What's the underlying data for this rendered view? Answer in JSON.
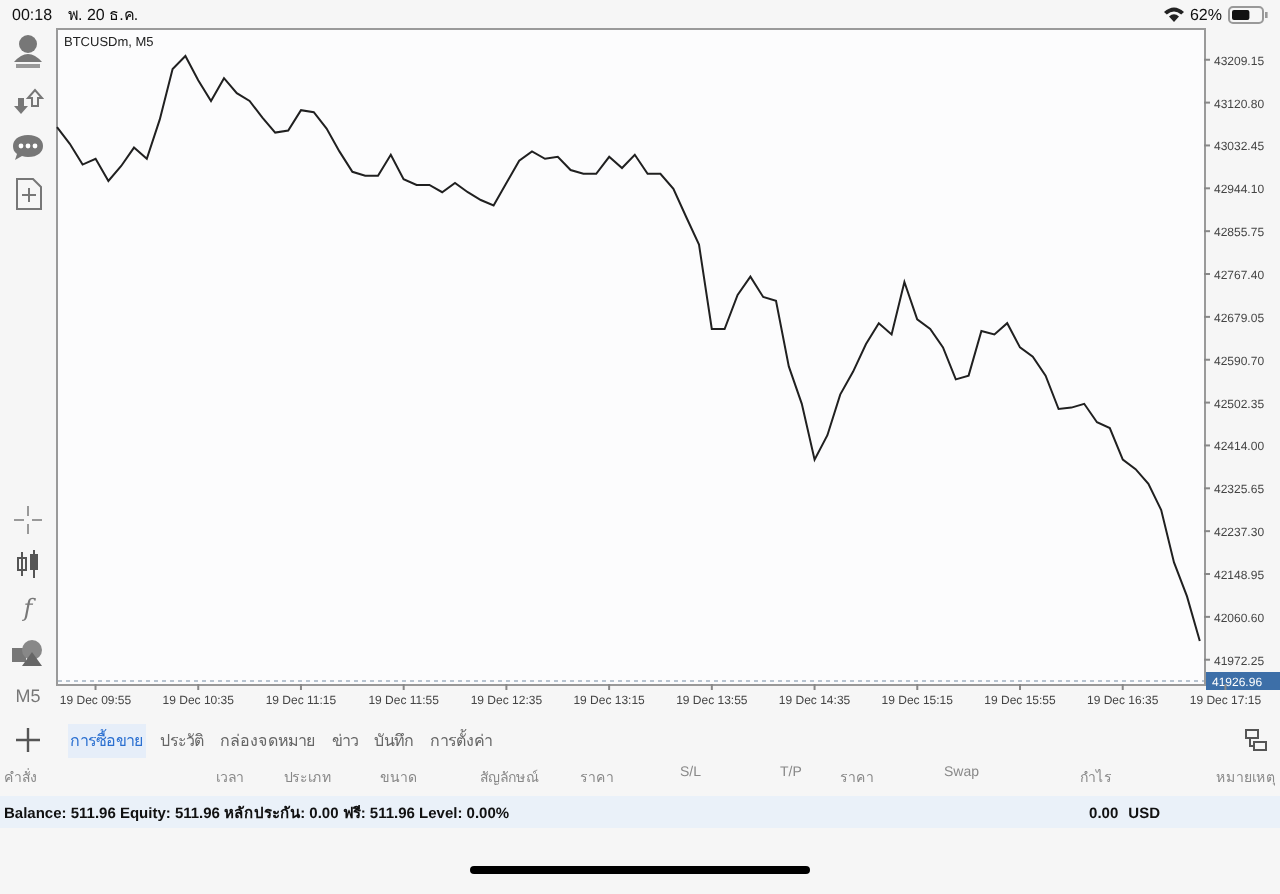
{
  "status_bar": {
    "time": "00:18",
    "date": "พ. 20 ธ.ค.",
    "battery_text": "62%"
  },
  "toolbar": [
    {
      "kind": "icon"
    },
    {
      "kind": "icon"
    },
    {
      "kind": "icon"
    },
    {
      "kind": "icon"
    },
    {
      "kind": "gap"
    },
    {
      "kind": "icon"
    },
    {
      "kind": "icon"
    },
    {
      "kind": "glyph",
      "text": "f"
    },
    {
      "kind": "icon"
    },
    {
      "kind": "text",
      "text": "M5"
    }
  ],
  "chart": {
    "title": "BTCUSDm, M5",
    "price_tag": "41926.96",
    "chart_data": {
      "type": "line",
      "categories": [
        null,
        null,
        null,
        "19 Dec 09:55",
        null,
        null,
        null,
        null,
        null,
        null,
        null,
        "19 Dec 10:35",
        null,
        null,
        null,
        null,
        null,
        null,
        null,
        "19 Dec 11:15",
        null,
        null,
        null,
        null,
        null,
        null,
        null,
        "19 Dec 11:55",
        null,
        null,
        null,
        null,
        null,
        null,
        null,
        "19 Dec 12:35",
        null,
        null,
        null,
        null,
        null,
        null,
        null,
        "19 Dec 13:15",
        null,
        null,
        null,
        null,
        null,
        null,
        null,
        "19 Dec 13:55",
        null,
        null,
        null,
        null,
        null,
        null,
        null,
        "19 Dec 14:35",
        null,
        null,
        null,
        null,
        null,
        null,
        null,
        "19 Dec 15:15",
        null,
        null,
        null,
        null,
        null,
        null,
        null,
        "19 Dec 15:55",
        null,
        null,
        null,
        null,
        null,
        null,
        null,
        "19 Dec 16:35",
        null,
        null,
        null,
        null,
        null,
        null,
        null,
        "19 Dec 17:15"
      ],
      "series": [
        {
          "color": "#202020",
          "values": [
            43070,
            43036,
            42993,
            43005,
            42959,
            42990,
            43028,
            43005,
            43086,
            43190,
            43217,
            43167,
            43124,
            43171,
            43140,
            43124,
            43090,
            43059,
            43063,
            43105,
            43101,
            43067,
            43020,
            42978,
            42970,
            42970,
            43013,
            42963,
            42951,
            42951,
            42936,
            42955,
            42936,
            42920,
            42909,
            42955,
            43001,
            43020,
            43005,
            43009,
            42982,
            42974,
            42974,
            43009,
            42986,
            43013,
            42974,
            42974,
            42943,
            42885,
            42828,
            42654,
            42654,
            42724,
            42762,
            42720,
            42712,
            42577,
            42500,
            42385,
            42435,
            42519,
            42566,
            42623,
            42666,
            42643,
            42751,
            42674,
            42654,
            42616,
            42550,
            42558,
            42650,
            42643,
            42666,
            42616,
            42597,
            42558,
            42489,
            42492,
            42500,
            42462,
            42450,
            42385,
            42365,
            42335,
            42281,
            42173,
            42103,
            42011,
            null,
            null
          ]
        }
      ],
      "ylim": [
        41922.2,
        43274.6
      ],
      "yticks": [
        {
          "value": 43209.15,
          "label": "43209.15"
        },
        {
          "value": 43120.8,
          "label": "43120.80"
        },
        {
          "value": 43032.45,
          "label": "43032.45"
        },
        {
          "value": 42944.1,
          "label": "42944.10"
        },
        {
          "value": 42855.75,
          "label": "42855.75"
        },
        {
          "value": 42767.4,
          "label": "42767.40"
        },
        {
          "value": 42679.05,
          "label": "42679.05"
        },
        {
          "value": 42590.7,
          "label": "42590.70"
        },
        {
          "value": 42502.35,
          "label": "42502.35"
        },
        {
          "value": 42414,
          "label": "42414.00"
        },
        {
          "value": 42325.65,
          "label": "42325.65"
        },
        {
          "value": 42237.3,
          "label": "42237.30"
        },
        {
          "value": 42148.95,
          "label": "42148.95"
        },
        {
          "value": 42060.6,
          "label": "42060.60"
        },
        {
          "value": 41972.25,
          "label": "41972.25"
        }
      ]
    }
  },
  "tabs": [
    {
      "label": "การซื้อขาย",
      "selected": true
    },
    {
      "label": "ประวัติ",
      "selected": false
    },
    {
      "label": "กล่องจดหมาย",
      "selected": false
    },
    {
      "label": "ข่าว",
      "selected": false
    },
    {
      "label": "บันทึก",
      "selected": false
    },
    {
      "label": "การตั้งค่า",
      "selected": false
    }
  ],
  "columns": [
    "คำสั่ง",
    "เวลา",
    "ประเภท",
    "ขนาด",
    "สัญลักษณ์",
    "ราคา",
    "S/L",
    "T/P",
    "ราคา",
    "Swap",
    "กำไร",
    "หมายเหตุ"
  ],
  "summary": {
    "text": "Balance: 511.96 Equity: 511.96 หลักประกัน: 0.00 ฟรี: 511.96 Level: 0.00%",
    "profit": "0.00",
    "currency": "USD"
  }
}
